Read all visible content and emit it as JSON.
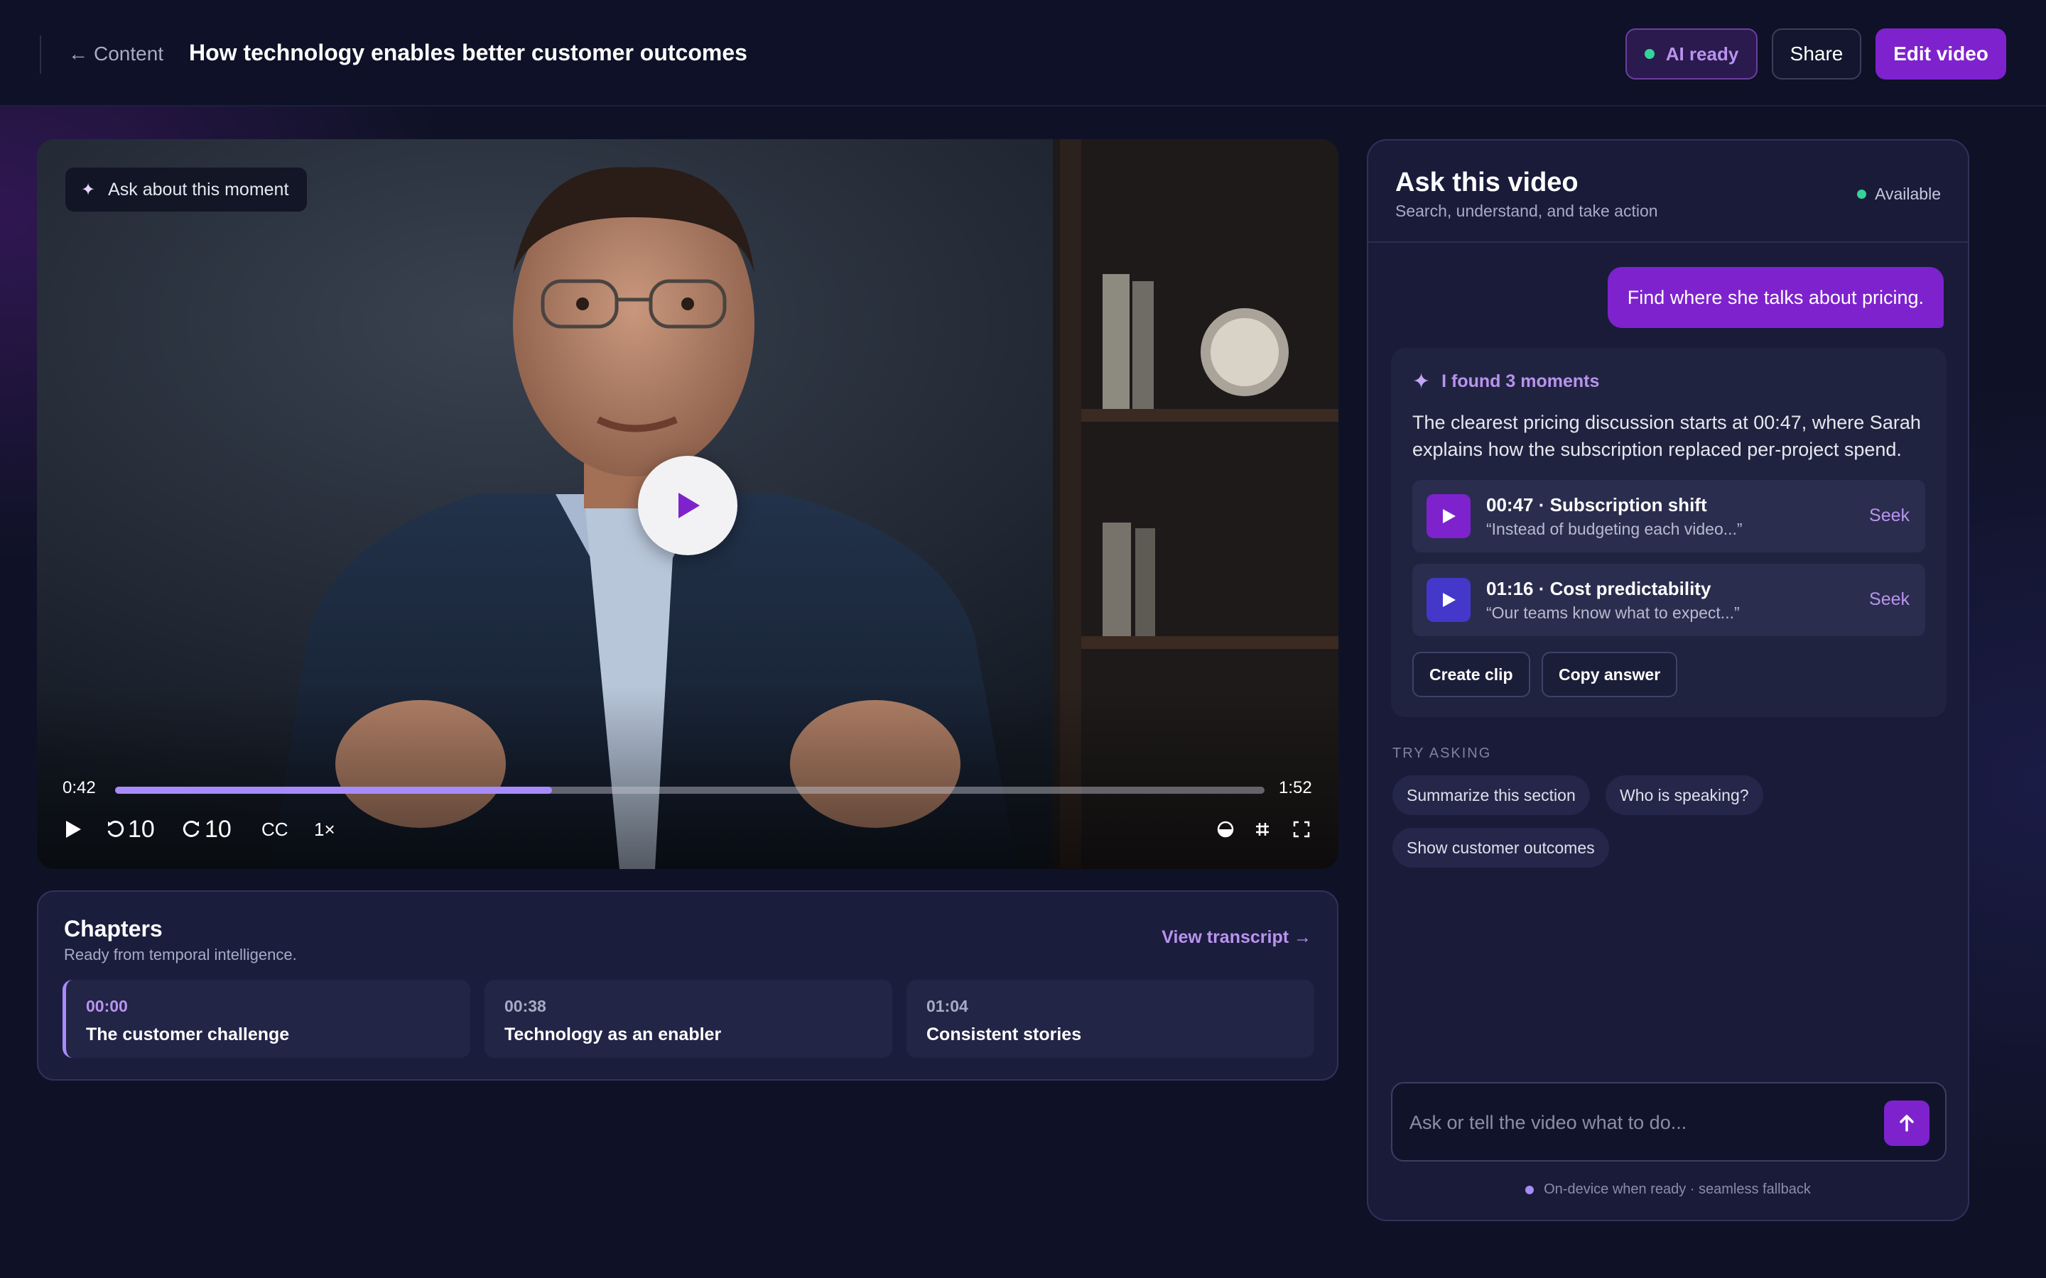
{
  "header": {
    "back_label": "Content",
    "title": "How technology enables better customer outcomes",
    "ai_badge": "AI ready",
    "share": "Share",
    "edit": "Edit video"
  },
  "video": {
    "ask_moment": "Ask about this moment",
    "current_time": "0:42",
    "duration": "1:52",
    "progress_fraction": 0.38,
    "rewind_label": "10",
    "forward_label": "10",
    "cc_label": "CC",
    "speed_label": "1×"
  },
  "chapters": {
    "title": "Chapters",
    "subtitle": "Ready from temporal intelligence.",
    "view_transcript": "View transcript →",
    "items": [
      {
        "time": "00:00",
        "title": "The customer challenge"
      },
      {
        "time": "00:38",
        "title": "Technology as an enabler"
      },
      {
        "time": "01:04",
        "title": "Consistent stories"
      }
    ]
  },
  "ask": {
    "title": "Ask this video",
    "subtitle": "Search, understand, and take action",
    "status": "Available",
    "user_message": "Find where she talks about pricing.",
    "answer_heading": "I found 3 moments",
    "answer_text": "The clearest pricing discussion starts at 00:47, where Sarah explains how the subscription replaced per-project spend.",
    "moments": [
      {
        "title": "00:47 · Subscription shift",
        "quote": "“Instead of budgeting each video...”",
        "seek": "Seek",
        "color": "#7e22ce"
      },
      {
        "title": "01:16 · Cost predictability",
        "quote": "“Our teams know what to expect...”",
        "seek": "Seek",
        "color": "#4338ca"
      }
    ],
    "actions": [
      "Create clip",
      "Copy answer"
    ],
    "try_label": "TRY ASKING",
    "suggestions": [
      "Summarize this section",
      "Who is speaking?",
      "Show customer outcomes"
    ],
    "input_placeholder": "Ask or tell the video what to do...",
    "footnote": "On-device when ready · seamless fallback"
  },
  "colors": {
    "accent": "#7e22ce",
    "accent_light": "#b993ee",
    "status_green": "#34d399"
  }
}
